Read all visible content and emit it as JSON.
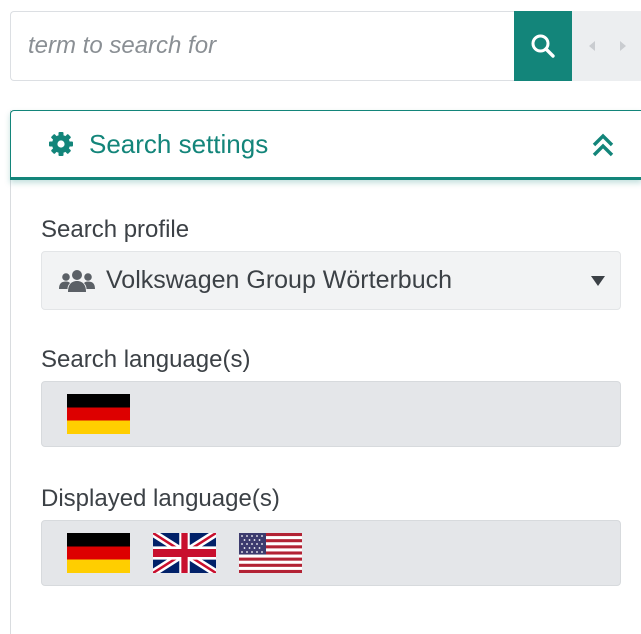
{
  "search": {
    "placeholder": "term to search for",
    "value": "",
    "button_icon": "search-icon",
    "nav": [
      "arrow-left-icon",
      "arrow-right-icon"
    ]
  },
  "settings": {
    "title": "Search settings",
    "icon": "gear-icon",
    "collapse_icon": "chevron-double-up-icon",
    "expanded": true,
    "profile": {
      "label": "Search profile",
      "value": "Volkswagen Group Wörterbuch",
      "icon": "users-icon"
    },
    "search_languages": {
      "label": "Search language(s)",
      "flags": [
        "german-flag"
      ]
    },
    "display_languages": {
      "label": "Displayed language(s)",
      "flags": [
        "german-flag",
        "uk-flag",
        "us-flag"
      ]
    }
  },
  "colors": {
    "accent": "#13857a",
    "text": "#3c4146",
    "field_bg": "#e4e6e9"
  }
}
